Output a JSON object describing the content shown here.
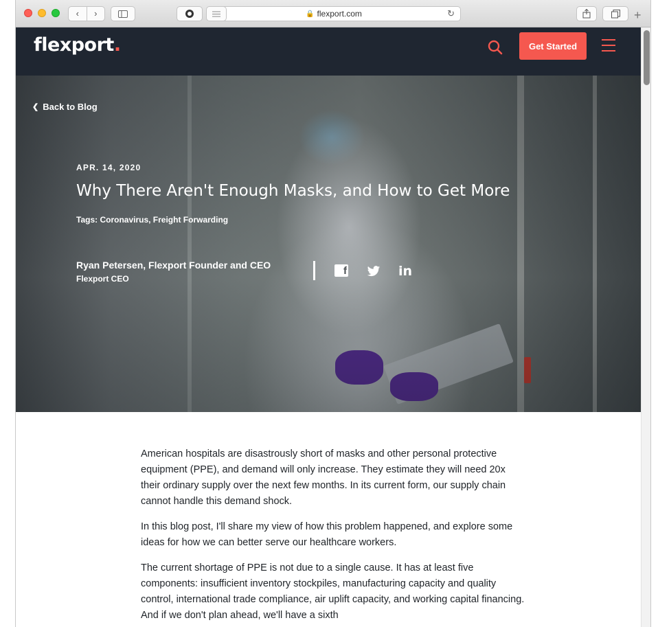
{
  "browser": {
    "url": "flexport.com",
    "icons": [
      "back-icon",
      "forward-icon",
      "sidebar-icon",
      "shield-icon",
      "reader-icon",
      "lock-icon",
      "reload-icon",
      "share-icon",
      "tabs-icon",
      "plus-icon"
    ]
  },
  "site": {
    "logo_text": "flexport",
    "logo_dot": ".",
    "cta_label": "Get Started",
    "brand_color": "#f5584f",
    "header_bg": "#1f2631"
  },
  "hero": {
    "back_label": "Back to Blog",
    "date": "APR. 14, 2020",
    "title": "Why There Aren't Enough Masks, and How to Get More",
    "tags": "Tags: Coronavirus, Freight Forwarding",
    "author_name": "Ryan Petersen, Flexport Founder and CEO",
    "author_role": "Flexport CEO",
    "social": [
      "facebook-icon",
      "twitter-icon",
      "linkedin-icon"
    ]
  },
  "article": {
    "paragraphs": [
      "American hospitals are disastrously short of masks and other personal protective equipment (PPE), and demand will only increase. They estimate they will need 20x their ordinary supply over the next few months. In its current form, our supply chain cannot handle this demand shock.",
      "In this blog post, I'll share my view of how this problem happened, and explore some ideas for how we can better serve our healthcare workers.",
      "The current shortage of PPE is not due to a single cause. It has at least five components: insufficient inventory stockpiles, manufacturing capacity and quality control, international trade compliance, air uplift capacity, and working capital financing. And if we don't plan ahead, we'll have a sixth"
    ]
  }
}
